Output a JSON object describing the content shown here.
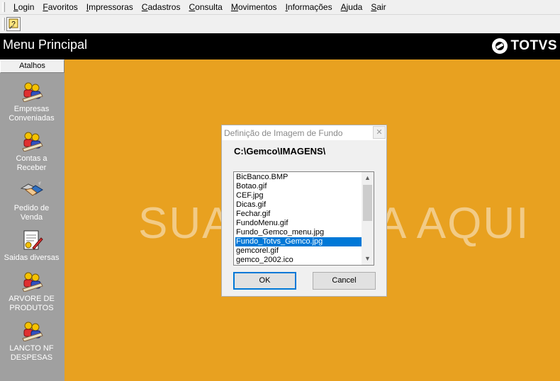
{
  "menubar": {
    "items": [
      "Login",
      "Favoritos",
      "Impressoras",
      "Cadastros",
      "Consulta",
      "Movimentos",
      "Informações",
      "Ajuda",
      "Sair"
    ]
  },
  "toolbar": {
    "icon": "help-key-icon"
  },
  "header": {
    "title": "Menu Principal",
    "logo_text": "TOTVS"
  },
  "sidebar": {
    "tab_label": "Atalhos",
    "items": [
      {
        "label": "Empresas\nConveniadas",
        "icon": "users-icon"
      },
      {
        "label": "Contas a\nReceber",
        "icon": "users-icon"
      },
      {
        "label": "Pedido de\nVenda",
        "icon": "handshake-icon"
      },
      {
        "label": "Saidas diversas",
        "icon": "document-pen-icon"
      },
      {
        "label": "ARVORE DE\nPRODUTOS",
        "icon": "users-icon"
      },
      {
        "label": "LANCTO NF\nDESPESAS",
        "icon": "users-icon"
      }
    ]
  },
  "background": {
    "text_left": "SUA",
    "text_right": "A AQUI",
    "color": "#e8a120"
  },
  "dialog": {
    "title": "Definição de Imagem de Fundo",
    "path": "C:\\Gemco\\IMAGENS\\",
    "files": [
      "BicBanco.BMP",
      "Botao.gif",
      "CEF.jpg",
      "Dicas.gif",
      "Fechar.gif",
      "FundoMenu.gif",
      "Fundo_Gemco_menu.jpg",
      "Fundo_Totvs_Gemco.jpg",
      "gemcorel.gif",
      "gemco_2002.ico"
    ],
    "selected_index": 7,
    "ok_label": "OK",
    "cancel_label": "Cancel",
    "selection_color": "#0078d7"
  }
}
